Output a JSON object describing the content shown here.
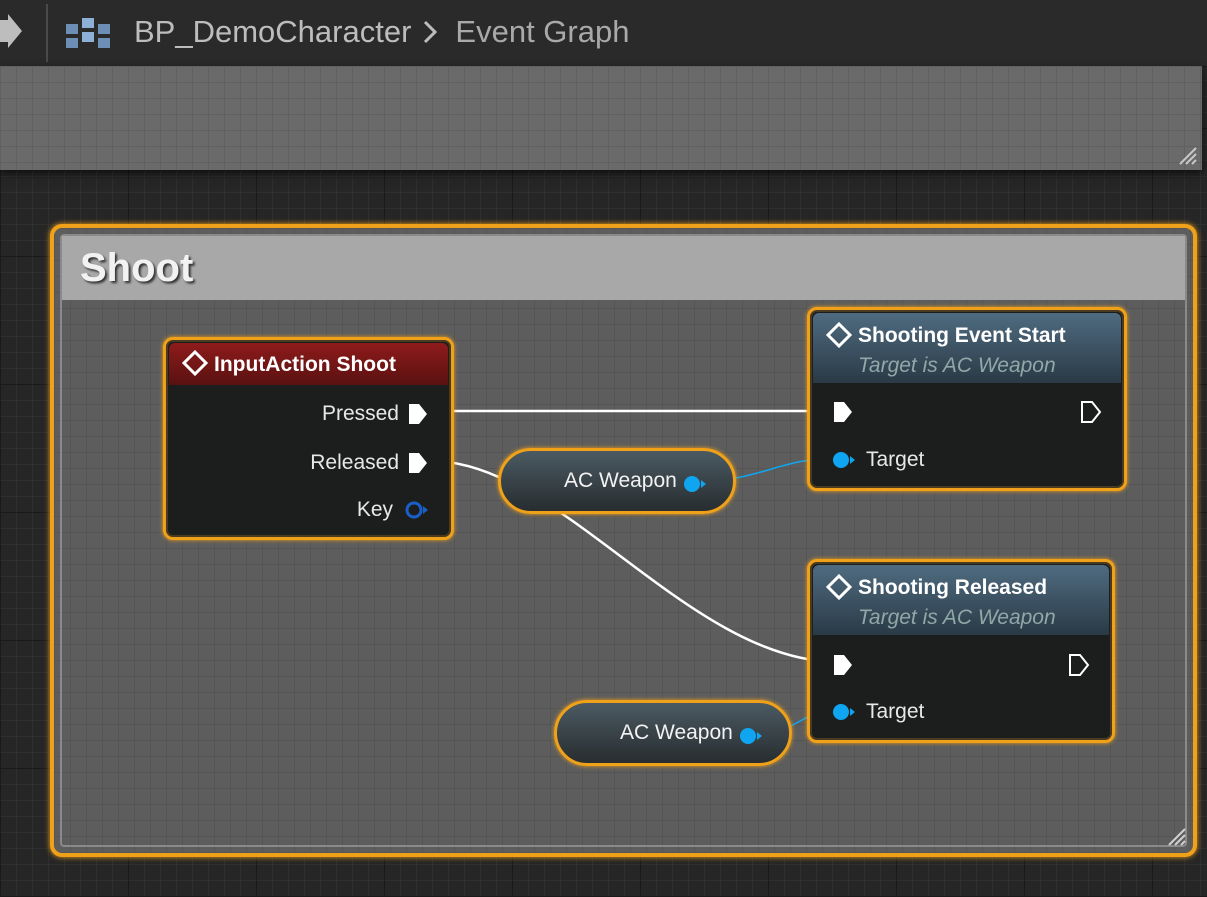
{
  "breadcrumb": {
    "blueprint": "BP_DemoCharacter",
    "graph": "Event Graph"
  },
  "comment": {
    "title": "Shoot"
  },
  "nodes": {
    "input_action": {
      "title": "InputAction Shoot",
      "pins": {
        "pressed": "Pressed",
        "released": "Released",
        "key": "Key"
      }
    },
    "shooting_start": {
      "title": "Shooting Event Start",
      "subtitle": "Target is AC Weapon",
      "pins": {
        "target": "Target"
      }
    },
    "shooting_released": {
      "title": "Shooting Released",
      "subtitle": "Target is AC Weapon",
      "pins": {
        "target": "Target"
      }
    },
    "weapon_var_1": {
      "label": "AC Weapon"
    },
    "weapon_var_2": {
      "label": "AC Weapon"
    }
  },
  "colors": {
    "selection_outline": "#f0a11a",
    "event_header": "#8e1b1b",
    "function_header": "#4f6b80",
    "object_pin": "#0fa5f0",
    "exec_pin": "#ffffff"
  },
  "icons": {
    "toolbar_arrow": "arrow-right-icon",
    "blueprint": "blueprint-icon",
    "breadcrumb_separator": "chevron-right-icon",
    "event": "event-diamond-icon"
  }
}
